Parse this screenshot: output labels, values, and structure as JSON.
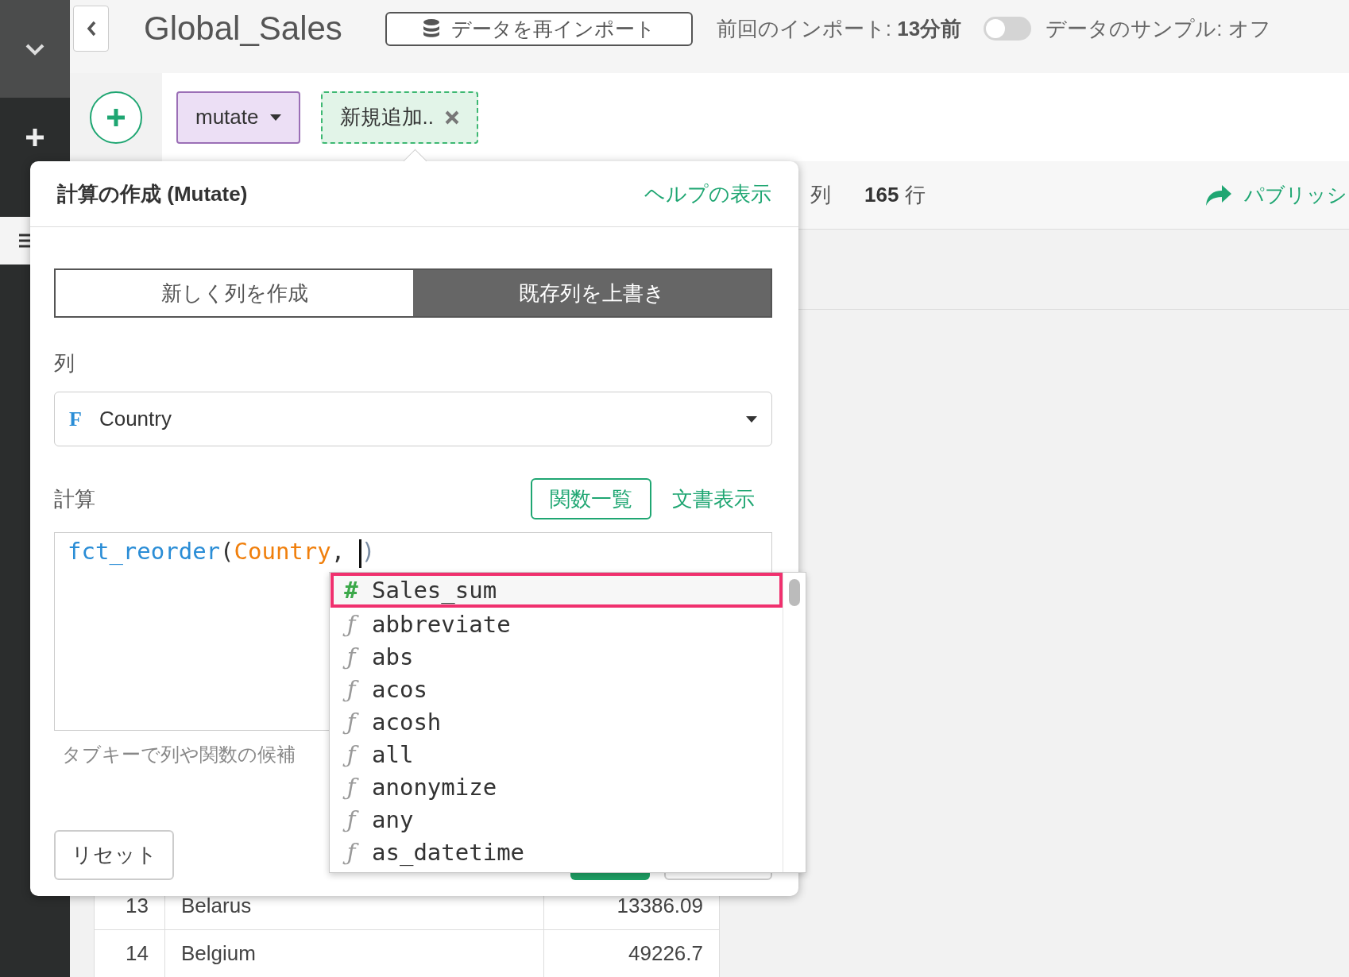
{
  "topbar": {
    "title": "Global_Sales",
    "reimport_button": "データを再インポート",
    "last_import": "前回のインポート: **13分前**",
    "sample_toggle": {
      "on": false,
      "label": "データのサンプル: オフ"
    }
  },
  "steps": [
    {
      "kind": "command",
      "label": "mutate"
    },
    {
      "kind": "new",
      "label": "新規追加.."
    }
  ],
  "stats": [
    "列",
    "**165** 行"
  ],
  "publish_button": "パブリッシ",
  "dialog": {
    "title": "計算の作成 (Mutate)",
    "help_link": "ヘルプの表示",
    "modes": [
      {
        "label": "新しく列を作成",
        "selected": false
      },
      {
        "label": "既存列を上書き",
        "selected": true
      }
    ],
    "column_label": "列",
    "column_select": {
      "type_badge": "F",
      "value": "Country"
    },
    "calc_label": "計算",
    "function_list_button": "関数一覧",
    "doc_link": "文書表示",
    "code": [
      {
        "kind": "function",
        "text": "fct_reorder"
      },
      {
        "kind": "punct",
        "text": "("
      },
      {
        "kind": "column",
        "text": "Country"
      },
      {
        "kind": "punct",
        "text": ", "
      },
      {
        "kind": "cursor"
      },
      {
        "kind": "paren",
        "text": ")"
      }
    ],
    "hint": "タブキーで列や関数の候補",
    "reset_button": "リセット"
  },
  "autocomplete": [
    {
      "kind": "column",
      "icon": "#",
      "label": "Sales_sum",
      "selected": true
    },
    {
      "kind": "function",
      "icon": "ƒ",
      "label": "abbreviate",
      "selected": false
    },
    {
      "kind": "function",
      "icon": "ƒ",
      "label": "abs",
      "selected": false
    },
    {
      "kind": "function",
      "icon": "ƒ",
      "label": "acos",
      "selected": false
    },
    {
      "kind": "function",
      "icon": "ƒ",
      "label": "acosh",
      "selected": false
    },
    {
      "kind": "function",
      "icon": "ƒ",
      "label": "all",
      "selected": false
    },
    {
      "kind": "function",
      "icon": "ƒ",
      "label": "anonymize",
      "selected": false
    },
    {
      "kind": "function",
      "icon": "ƒ",
      "label": "any",
      "selected": false
    },
    {
      "kind": "function",
      "icon": "ƒ",
      "label": "as_datetime",
      "selected": false
    }
  ],
  "table": {
    "rows": [
      {
        "index": "13",
        "country": "Belarus",
        "value": "13386.09"
      },
      {
        "index": "14",
        "country": "Belgium",
        "value": "49226.7"
      }
    ]
  }
}
